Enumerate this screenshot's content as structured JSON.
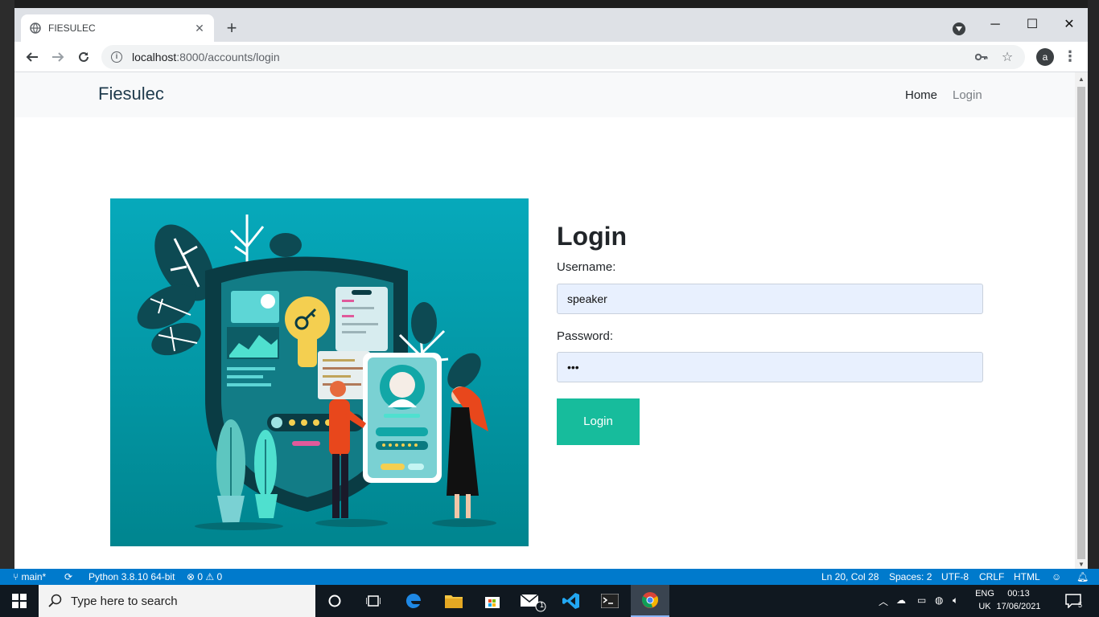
{
  "browser": {
    "tab_title": "FIESULEC",
    "url_host": "localhost",
    "url_rest": ":8000/accounts/login",
    "new_tab_symbol": "+",
    "profile_initial": "a"
  },
  "site": {
    "brand": "Fiesulec",
    "nav": {
      "home": "Home",
      "login": "Login"
    }
  },
  "login": {
    "heading": "Login",
    "username_label": "Username:",
    "username_value": "speaker",
    "password_label": "Password:",
    "password_value": "•••",
    "button_label": "Login"
  },
  "statusbar": {
    "branch": "main*",
    "python": "Python 3.8.10 64-bit",
    "problems": "⊗ 0 ⚠ 0",
    "position": "Ln 20, Col 28",
    "spaces": "Spaces: 2",
    "encoding": "UTF-8",
    "eol": "CRLF",
    "language": "HTML"
  },
  "taskbar": {
    "search_placeholder": "Type here to search",
    "lang_top": "ENG",
    "lang_bottom": "UK",
    "time": "00:13",
    "date": "17/06/2021",
    "notification_count": "5",
    "mail_badge": "1"
  },
  "colors": {
    "accent_button": "#17bc9c",
    "illustration_bg": "#0aa3b0",
    "statusbar": "#007acc"
  }
}
